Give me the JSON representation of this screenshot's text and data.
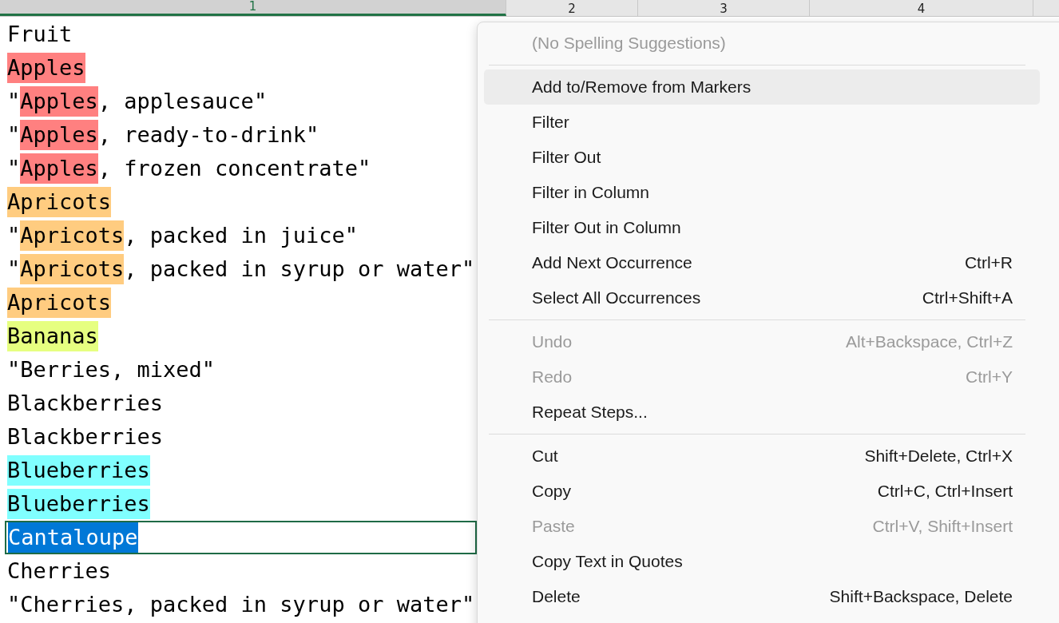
{
  "columns": [
    {
      "label": "1",
      "selected": true
    },
    {
      "label": "2",
      "selected": false
    },
    {
      "label": "3",
      "selected": false
    },
    {
      "label": "4",
      "selected": false
    }
  ],
  "rows": [
    {
      "selected": false,
      "segments": [
        {
          "text": "Fruit"
        }
      ]
    },
    {
      "selected": false,
      "segments": [
        {
          "text": "Apples",
          "color": "#ff8080"
        }
      ]
    },
    {
      "selected": false,
      "segments": [
        {
          "text": "\""
        },
        {
          "text": "Apples",
          "color": "#ff8080"
        },
        {
          "text": ", applesauce\""
        }
      ]
    },
    {
      "selected": false,
      "segments": [
        {
          "text": "\""
        },
        {
          "text": "Apples",
          "color": "#ff8080"
        },
        {
          "text": ", ready-to-drink\""
        }
      ]
    },
    {
      "selected": false,
      "segments": [
        {
          "text": "\""
        },
        {
          "text": "Apples",
          "color": "#ff8080"
        },
        {
          "text": ", frozen concentrate\""
        }
      ]
    },
    {
      "selected": false,
      "segments": [
        {
          "text": "Apricots",
          "color": "#ffcc80"
        }
      ]
    },
    {
      "selected": false,
      "segments": [
        {
          "text": "\""
        },
        {
          "text": "Apricots",
          "color": "#ffcc80"
        },
        {
          "text": ", packed in juice\""
        }
      ]
    },
    {
      "selected": false,
      "segments": [
        {
          "text": "\""
        },
        {
          "text": "Apricots",
          "color": "#ffcc80"
        },
        {
          "text": ", packed in syrup or water\""
        }
      ]
    },
    {
      "selected": false,
      "segments": [
        {
          "text": "Apricots",
          "color": "#ffcc80"
        }
      ]
    },
    {
      "selected": false,
      "segments": [
        {
          "text": "Bananas",
          "color": "#e6ff80"
        }
      ]
    },
    {
      "selected": false,
      "segments": [
        {
          "text": "\"Berries, mixed\""
        }
      ]
    },
    {
      "selected": false,
      "segments": [
        {
          "text": "Blackberries"
        }
      ]
    },
    {
      "selected": false,
      "segments": [
        {
          "text": "Blackberries"
        }
      ]
    },
    {
      "selected": false,
      "segments": [
        {
          "text": "Blueberries",
          "color": "#80ffff"
        }
      ]
    },
    {
      "selected": false,
      "segments": [
        {
          "text": "Blueberries",
          "color": "#80ffff"
        }
      ]
    },
    {
      "selected": true,
      "segments": [
        {
          "text": "Cantaloupe"
        }
      ]
    },
    {
      "selected": false,
      "segments": [
        {
          "text": "Cherries"
        }
      ]
    },
    {
      "selected": false,
      "segments": [
        {
          "text": "\"Cherries, packed in syrup or water\""
        }
      ]
    }
  ],
  "context_menu": [
    {
      "kind": "header",
      "label": "(No Spelling Suggestions)",
      "disabled": true
    },
    {
      "kind": "separator"
    },
    {
      "kind": "item",
      "label": "Add to/Remove from Markers",
      "disabled": false,
      "highlighted": true
    },
    {
      "kind": "item",
      "label": "Filter",
      "disabled": false,
      "highlighted": false
    },
    {
      "kind": "item",
      "label": "Filter Out",
      "disabled": false,
      "highlighted": false
    },
    {
      "kind": "item",
      "label": "Filter in Column",
      "disabled": false,
      "highlighted": false
    },
    {
      "kind": "item",
      "label": "Filter Out in Column",
      "disabled": false,
      "highlighted": false
    },
    {
      "kind": "item",
      "label": "Add Next Occurrence",
      "shortcut": "Ctrl+R",
      "disabled": false,
      "highlighted": false
    },
    {
      "kind": "item",
      "label": "Select All Occurrences",
      "shortcut": "Ctrl+Shift+A",
      "disabled": false,
      "highlighted": false
    },
    {
      "kind": "separator"
    },
    {
      "kind": "item",
      "label": "Undo",
      "shortcut": "Alt+Backspace, Ctrl+Z",
      "disabled": true,
      "highlighted": false
    },
    {
      "kind": "item",
      "label": "Redo",
      "shortcut": "Ctrl+Y",
      "disabled": true,
      "highlighted": false
    },
    {
      "kind": "item",
      "label": "Repeat Steps...",
      "disabled": false,
      "highlighted": false
    },
    {
      "kind": "separator"
    },
    {
      "kind": "item",
      "label": "Cut",
      "shortcut": "Shift+Delete, Ctrl+X",
      "disabled": false,
      "highlighted": false
    },
    {
      "kind": "item",
      "label": "Copy",
      "shortcut": "Ctrl+C, Ctrl+Insert",
      "disabled": false,
      "highlighted": false
    },
    {
      "kind": "item",
      "label": "Paste",
      "shortcut": "Ctrl+V, Shift+Insert",
      "disabled": true,
      "highlighted": false
    },
    {
      "kind": "item",
      "label": "Copy Text in Quotes",
      "disabled": false,
      "highlighted": false
    },
    {
      "kind": "item",
      "label": "Delete",
      "shortcut": "Shift+Backspace, Delete",
      "disabled": false,
      "highlighted": false
    }
  ]
}
